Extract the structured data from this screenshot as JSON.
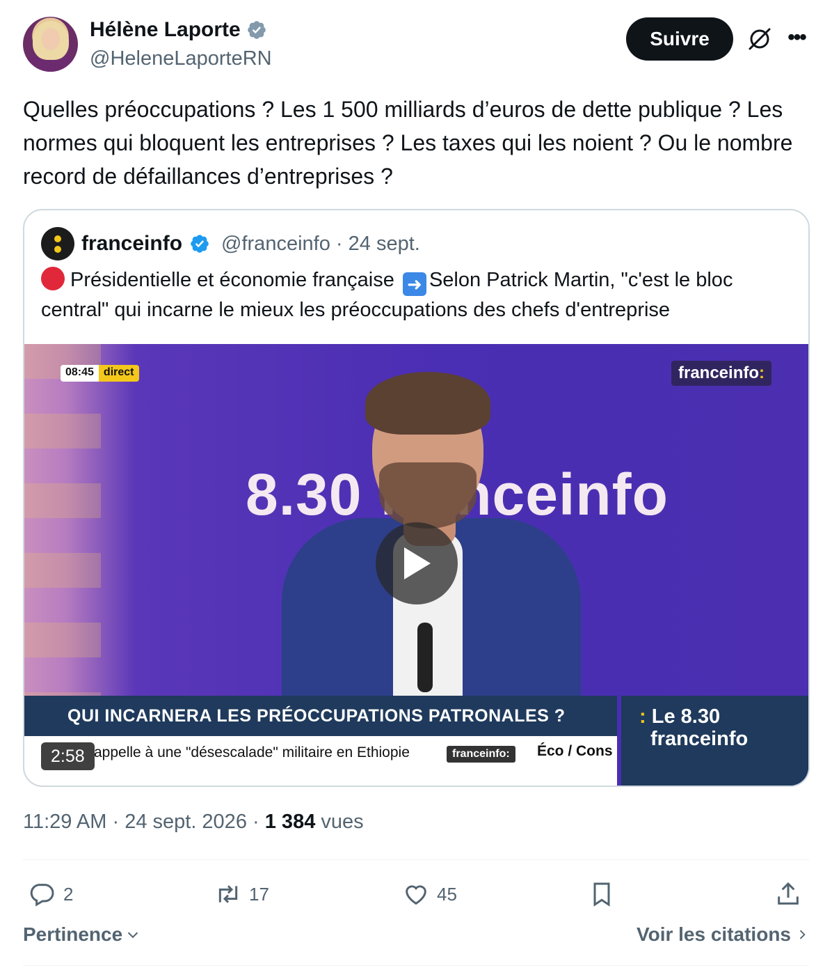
{
  "author": {
    "name": "Hélène Laporte",
    "handle": "@HeleneLaporteRN",
    "follow_label": "Suivre"
  },
  "tweet": {
    "text": "Quelles préoccupations ? Les 1 500 milliards d’euros de dette publique ? Les normes qui bloquent les entreprises ? Les taxes qui les noient ? Ou le nombre record de défaillances d’entreprises ?"
  },
  "quoted": {
    "name": "franceinfo",
    "handle": "@franceinfo",
    "separator": "·",
    "date": "24 sept.",
    "text_part1": "Présidentielle et économie française",
    "text_part2": "Selon Patrick Martin, \"c'est le bloc central\" qui incarne le mieux les préoccupations des chefs d'entreprise",
    "video": {
      "live_time": "08:45",
      "live_label": "direct",
      "channel_logo": "franceinfo",
      "channel_logo_colon": ":",
      "studio_title": "8.30 franceinfo",
      "banner": "QUI INCARNERA LES PRÉOCCUPATIONS PATRONALES ?",
      "ticker_text": "appelle à une \"désescalade\" militaire en Ethiopie",
      "ticker_logo": "franceinfo:",
      "ticker_section": "Éco / Cons",
      "side_colon": ":",
      "side_line1": "Le 8.30",
      "side_line2": "franceinfo",
      "duration": "2:58"
    }
  },
  "meta": {
    "time": "11:29 AM",
    "dot": "·",
    "date": "24 sept. 2026",
    "views_count": "1 384",
    "views_label": "vues"
  },
  "actions": {
    "replies": "2",
    "reposts": "17",
    "likes": "45"
  },
  "footer": {
    "sort_label": "Pertinence",
    "quotes_label": "Voir les citations"
  },
  "colors": {
    "text": "#0f1419",
    "muted": "#536471",
    "verified": "#1d9bf0",
    "border": "#cfd9de"
  }
}
